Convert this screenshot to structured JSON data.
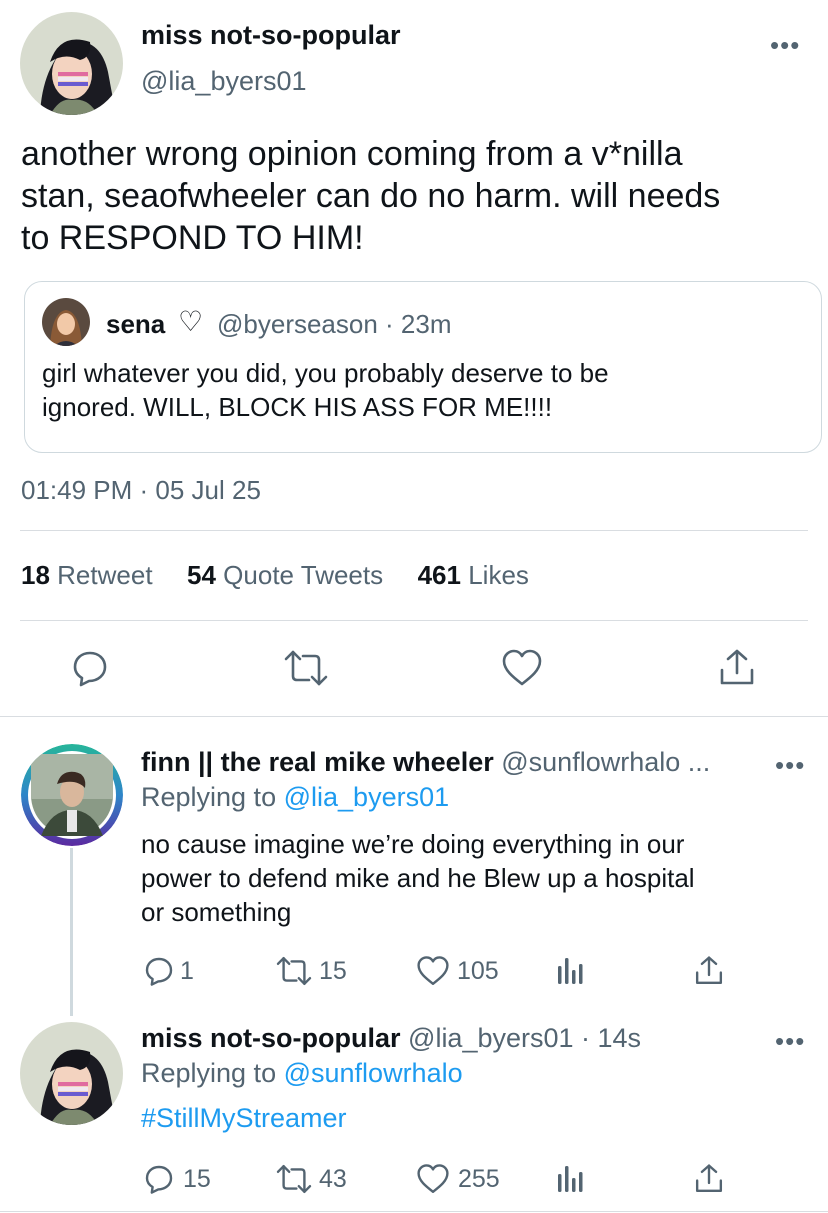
{
  "main_tweet": {
    "display_name": "miss not-so-popular",
    "handle": "@lia_byers01",
    "text_line1": "another wrong opinion coming from a v*nilla",
    "text_line2": "stan, seaofwheeler can do no harm. will needs",
    "text_line3": "to RESPOND TO HIM!",
    "more_label": "•••",
    "timestamp": "01:49 PM · 05 Jul 25",
    "stats": {
      "retweets": "18",
      "retweets_label": "Retweet",
      "quotes": "54",
      "quotes_label": "Quote Tweets",
      "likes": "461",
      "likes_label": "Likes"
    }
  },
  "quoted_tweet": {
    "display_name": "sena",
    "heart_symbol": "♡",
    "handle_time": "@byerseason · 23m",
    "text_line1": "girl whatever you did, you probably deserve to be",
    "text_line2": "ignored. WILL, BLOCK HIS ASS FOR ME!!!!"
  },
  "replies": [
    {
      "display_name": "finn || the real mike wheeler",
      "handle": "@sunflowrhalo ...",
      "replying_prefix": "Replying to",
      "replying_to": "@lia_byers01",
      "text_line1": "no cause imagine we’re doing everything in our",
      "text_line2": "power to defend mike and he Blew up a hospital",
      "text_line3": "or something",
      "replies": "1",
      "retweets": "15",
      "likes": "105",
      "more_label": "•••"
    },
    {
      "display_name": "miss not-so-popular",
      "handle_time": "@lia_byers01 · 14s",
      "replying_prefix": "Replying to",
      "replying_to": "@sunflowrhalo",
      "hashtag": "#StillMyStreamer",
      "replies": "15",
      "retweets": "43",
      "likes": "255",
      "more_label": "•••"
    }
  ],
  "colors": {
    "link": "#1d9bf0",
    "muted": "#536471",
    "text": "#0f1419",
    "divider": "#d9dde1"
  },
  "icons": [
    "reply-icon",
    "retweet-icon",
    "like-icon",
    "share-icon",
    "analytics-icon",
    "heart-outline-icon",
    "more-icon"
  ]
}
